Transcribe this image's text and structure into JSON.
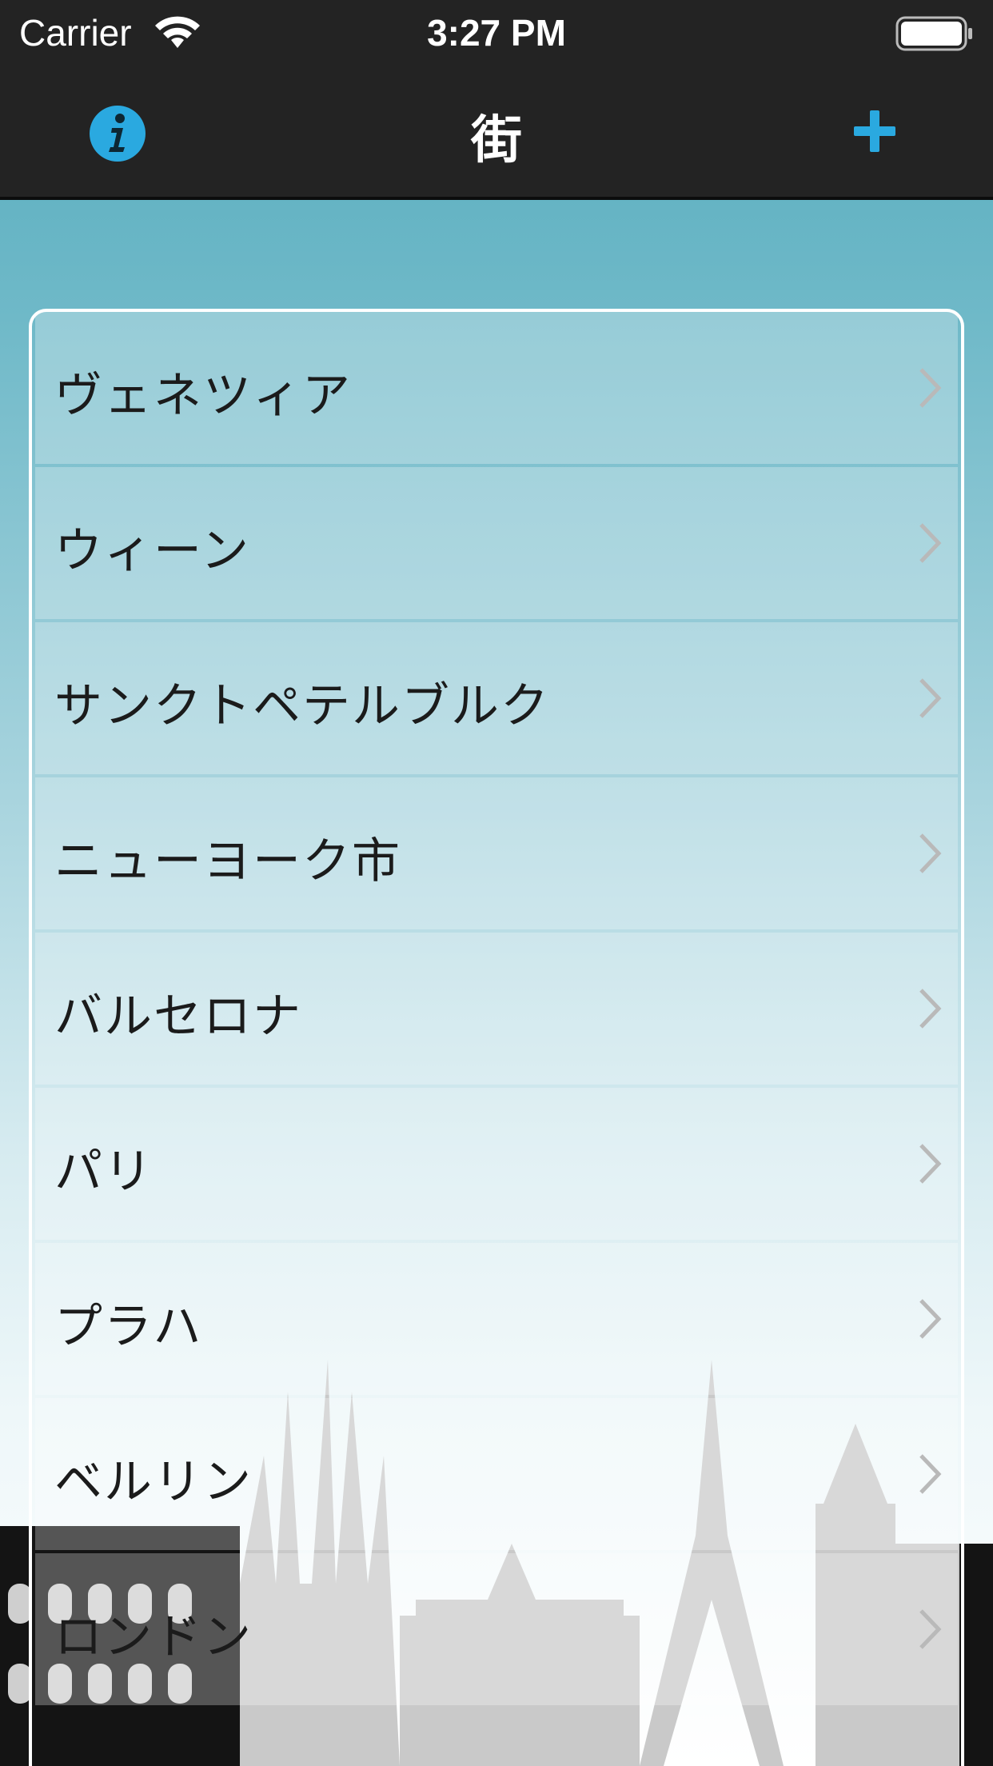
{
  "status_bar": {
    "carrier": "Carrier",
    "time": "3:27 PM"
  },
  "nav": {
    "title": "街",
    "left_icon": "info-icon",
    "right_icon": "plus-icon"
  },
  "colors": {
    "accent": "#2aa9e0",
    "bar_background": "#232323"
  },
  "cities": [
    {
      "name": "ヴェネツィア"
    },
    {
      "name": "ウィーン"
    },
    {
      "name": "サンクトペテルブルク"
    },
    {
      "name": "ニューヨーク市"
    },
    {
      "name": "バルセロナ"
    },
    {
      "name": "パリ"
    },
    {
      "name": "プラハ"
    },
    {
      "name": "ベルリン"
    },
    {
      "name": "ロンドン"
    }
  ]
}
